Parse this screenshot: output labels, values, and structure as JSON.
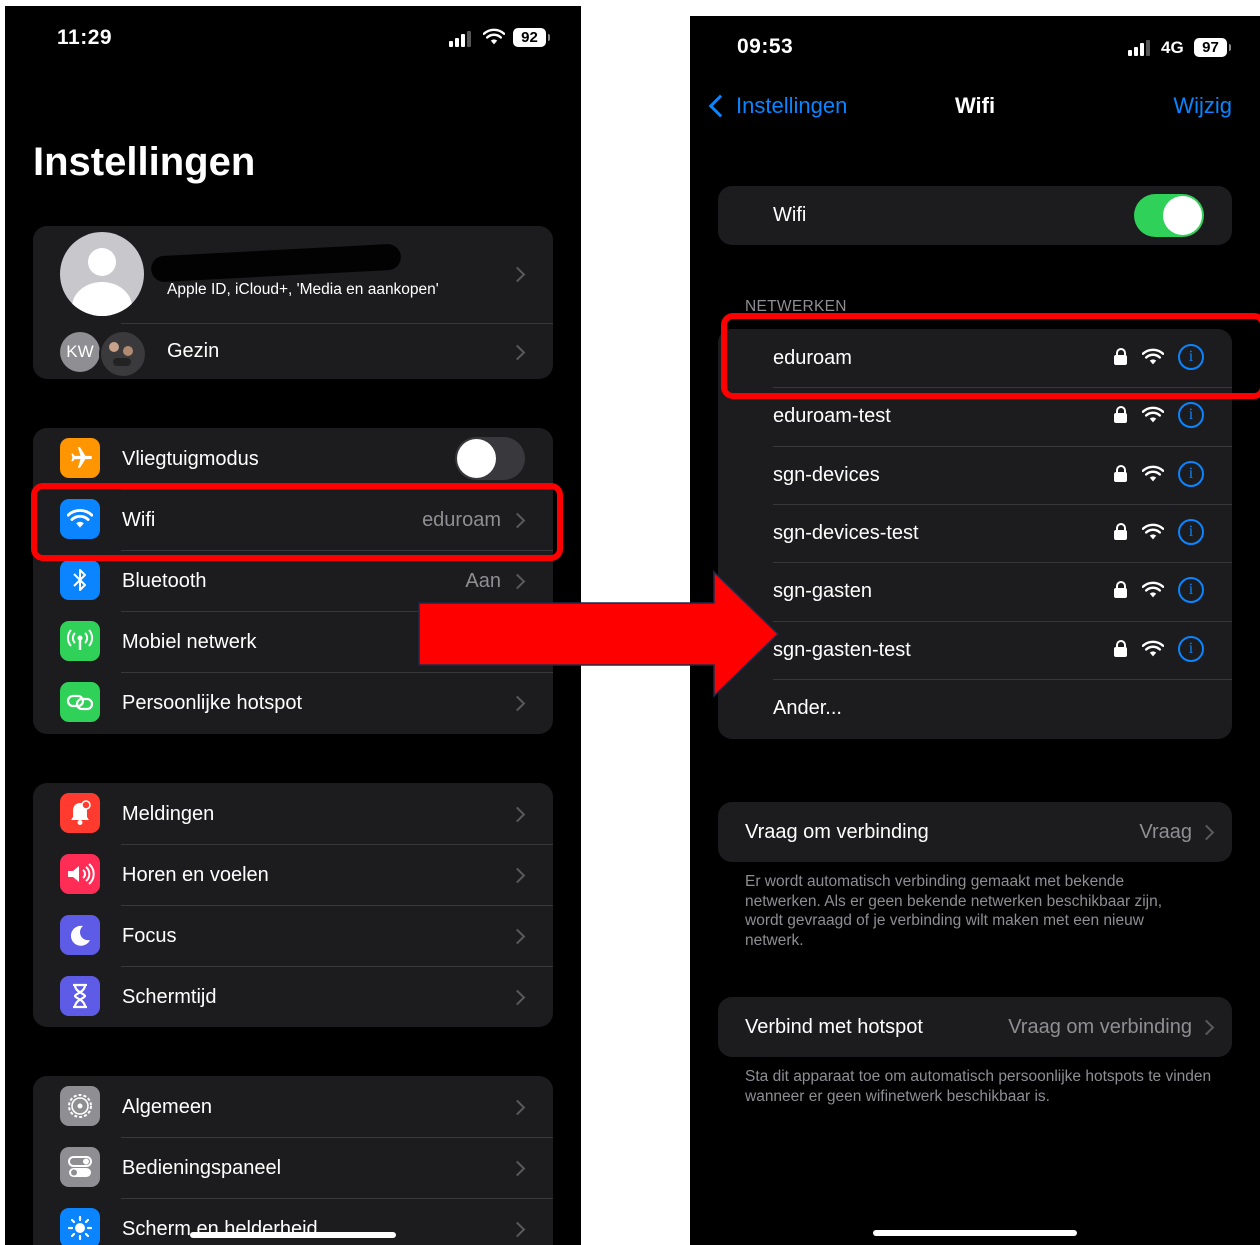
{
  "left": {
    "status_time": "11:29",
    "battery": "92",
    "title": "Instellingen",
    "account_subtitle": "Apple ID, iCloud+, 'Media en aankopen'",
    "family": {
      "initials": "KW",
      "label": "Gezin"
    },
    "connectivity": [
      {
        "label": "Vliegtuigmodus",
        "value": "",
        "icon": "airplane-icon",
        "color": "#ff9500"
      },
      {
        "label": "Wifi",
        "value": "eduroam",
        "icon": "wifi-icon",
        "color": "#0a84ff"
      },
      {
        "label": "Bluetooth",
        "value": "Aan",
        "icon": "bluetooth-icon",
        "color": "#0a84ff"
      },
      {
        "label": "Mobiel netwerk",
        "value": "",
        "icon": "antenna-icon",
        "color": "#30d158"
      },
      {
        "label": "Persoonlijke hotspot",
        "value": "",
        "icon": "hotspot-icon",
        "color": "#30d158"
      }
    ],
    "notifications": [
      {
        "label": "Meldingen",
        "icon": "bell-icon",
        "color": "#ff3b30"
      },
      {
        "label": "Horen en voelen",
        "icon": "speaker-icon",
        "color": "#ff2d55"
      },
      {
        "label": "Focus",
        "icon": "moon-icon",
        "color": "#5e5ce6"
      },
      {
        "label": "Schermtijd",
        "icon": "hourglass-icon",
        "color": "#5e5ce6"
      }
    ],
    "general": [
      {
        "label": "Algemeen",
        "icon": "gear-icon",
        "color": "#8e8e93"
      },
      {
        "label": "Bedieningspaneel",
        "icon": "toggles-icon",
        "color": "#8e8e93"
      },
      {
        "label": "Scherm en helderheid",
        "icon": "sun-icon",
        "color": "#0a84ff"
      }
    ]
  },
  "right": {
    "status_time": "09:53",
    "network_type": "4G",
    "battery": "97",
    "back_label": "Instellingen",
    "title": "Wifi",
    "edit_label": "Wijzig",
    "wifi_toggle_label": "Wifi",
    "wifi_on": true,
    "networks_header": "NETWERKEN",
    "networks": [
      "eduroam",
      "eduroam-test",
      "sgn-devices",
      "sgn-devices-test",
      "sgn-gasten",
      "sgn-gasten-test"
    ],
    "other_label": "Ander...",
    "ask_join": {
      "label": "Vraag om verbinding",
      "value": "Vraag"
    },
    "ask_join_footer": "Er wordt automatisch verbinding gemaakt met bekende netwerken. Als er geen bekende netwerken beschikbaar zijn, wordt gevraagd of je verbinding wilt maken met een nieuw netwerk.",
    "hotspot": {
      "label": "Verbind met hotspot",
      "value": "Vraag om verbinding"
    },
    "hotspot_footer": "Sta dit apparaat toe om automatisch persoonlijke hotspots te vinden wanneer er geen wifinetwerk beschikbaar is."
  },
  "colors": {
    "accent": "#0a84ff",
    "highlight": "#ff0000",
    "toggle_on": "#30d158"
  }
}
